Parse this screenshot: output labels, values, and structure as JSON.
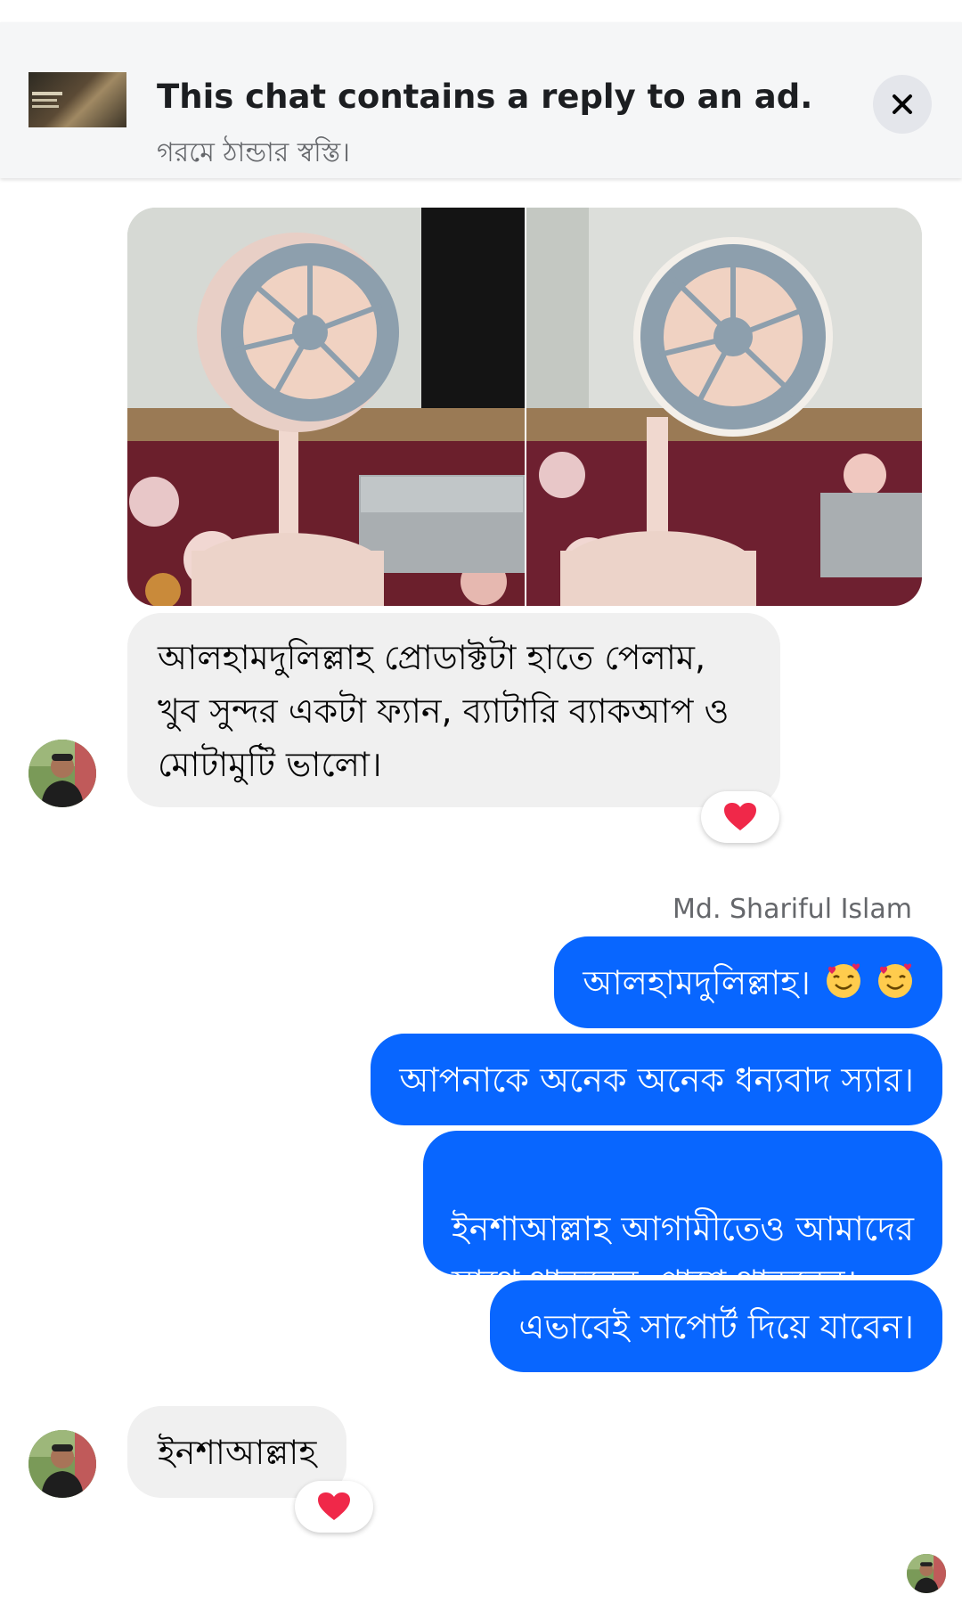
{
  "ad_banner": {
    "title": "This chat contains a reply to an ad.",
    "subtitle": "গরমে ঠান্ডার স্বস্তি।",
    "thumb_icon": "ad-thumbnail",
    "close_icon": "close-icon"
  },
  "messages": {
    "incoming_1": {
      "text": "আলহামদুলিল্লাহ প্রোডাক্টটা হাতে পেলাম, খুব সুন্দর একটা ফ্যান, ব্যাটারি ব্যাকআপ ও মোটামুটি ভালো।",
      "reaction": "heart-icon"
    },
    "sender_name": "Md. Shariful Islam",
    "outgoing": [
      {
        "text": "আলহামদুলিল্লাহ।",
        "emoji": "smiling-face-with-hearts-icon"
      },
      {
        "text": "আপনাকে অনেক অনেক ধন্যবাদ স্যার।"
      },
      {
        "text": "ইনশাআল্লাহ আগামীতেও আমাদের\nসাথে থাকবেন, পাশে থাকবেন।"
      },
      {
        "text": "এভাবেই সাপোর্ট দিয়ে যাবেন।"
      }
    ],
    "incoming_2": {
      "text": "ইনশাআল্লাহ",
      "reaction": "heart-icon"
    }
  },
  "colors": {
    "outgoing_bubble": "#0866ff",
    "incoming_bubble": "#f0f0f0",
    "banner_bg": "#f5f6f7",
    "reaction_heart": "#f02849"
  }
}
